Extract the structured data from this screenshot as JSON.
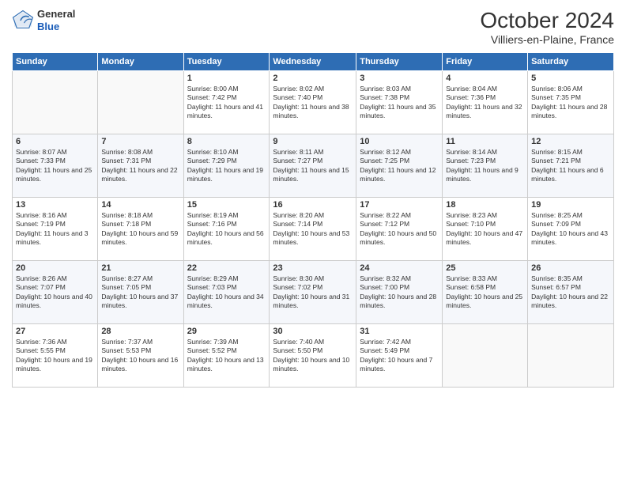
{
  "header": {
    "logo": {
      "general": "General",
      "blue": "Blue"
    },
    "title": "October 2024",
    "subtitle": "Villiers-en-Plaine, France"
  },
  "days_of_week": [
    "Sunday",
    "Monday",
    "Tuesday",
    "Wednesday",
    "Thursday",
    "Friday",
    "Saturday"
  ],
  "weeks": [
    [
      null,
      null,
      {
        "day": 1,
        "sunrise": "8:00 AM",
        "sunset": "7:42 PM",
        "daylight": "11 hours and 41 minutes."
      },
      {
        "day": 2,
        "sunrise": "8:02 AM",
        "sunset": "7:40 PM",
        "daylight": "11 hours and 38 minutes."
      },
      {
        "day": 3,
        "sunrise": "8:03 AM",
        "sunset": "7:38 PM",
        "daylight": "11 hours and 35 minutes."
      },
      {
        "day": 4,
        "sunrise": "8:04 AM",
        "sunset": "7:36 PM",
        "daylight": "11 hours and 32 minutes."
      },
      {
        "day": 5,
        "sunrise": "8:06 AM",
        "sunset": "7:35 PM",
        "daylight": "11 hours and 28 minutes."
      }
    ],
    [
      {
        "day": 6,
        "sunrise": "8:07 AM",
        "sunset": "7:33 PM",
        "daylight": "11 hours and 25 minutes."
      },
      {
        "day": 7,
        "sunrise": "8:08 AM",
        "sunset": "7:31 PM",
        "daylight": "11 hours and 22 minutes."
      },
      {
        "day": 8,
        "sunrise": "8:10 AM",
        "sunset": "7:29 PM",
        "daylight": "11 hours and 19 minutes."
      },
      {
        "day": 9,
        "sunrise": "8:11 AM",
        "sunset": "7:27 PM",
        "daylight": "11 hours and 15 minutes."
      },
      {
        "day": 10,
        "sunrise": "8:12 AM",
        "sunset": "7:25 PM",
        "daylight": "11 hours and 12 minutes."
      },
      {
        "day": 11,
        "sunrise": "8:14 AM",
        "sunset": "7:23 PM",
        "daylight": "11 hours and 9 minutes."
      },
      {
        "day": 12,
        "sunrise": "8:15 AM",
        "sunset": "7:21 PM",
        "daylight": "11 hours and 6 minutes."
      }
    ],
    [
      {
        "day": 13,
        "sunrise": "8:16 AM",
        "sunset": "7:19 PM",
        "daylight": "11 hours and 3 minutes."
      },
      {
        "day": 14,
        "sunrise": "8:18 AM",
        "sunset": "7:18 PM",
        "daylight": "10 hours and 59 minutes."
      },
      {
        "day": 15,
        "sunrise": "8:19 AM",
        "sunset": "7:16 PM",
        "daylight": "10 hours and 56 minutes."
      },
      {
        "day": 16,
        "sunrise": "8:20 AM",
        "sunset": "7:14 PM",
        "daylight": "10 hours and 53 minutes."
      },
      {
        "day": 17,
        "sunrise": "8:22 AM",
        "sunset": "7:12 PM",
        "daylight": "10 hours and 50 minutes."
      },
      {
        "day": 18,
        "sunrise": "8:23 AM",
        "sunset": "7:10 PM",
        "daylight": "10 hours and 47 minutes."
      },
      {
        "day": 19,
        "sunrise": "8:25 AM",
        "sunset": "7:09 PM",
        "daylight": "10 hours and 43 minutes."
      }
    ],
    [
      {
        "day": 20,
        "sunrise": "8:26 AM",
        "sunset": "7:07 PM",
        "daylight": "10 hours and 40 minutes."
      },
      {
        "day": 21,
        "sunrise": "8:27 AM",
        "sunset": "7:05 PM",
        "daylight": "10 hours and 37 minutes."
      },
      {
        "day": 22,
        "sunrise": "8:29 AM",
        "sunset": "7:03 PM",
        "daylight": "10 hours and 34 minutes."
      },
      {
        "day": 23,
        "sunrise": "8:30 AM",
        "sunset": "7:02 PM",
        "daylight": "10 hours and 31 minutes."
      },
      {
        "day": 24,
        "sunrise": "8:32 AM",
        "sunset": "7:00 PM",
        "daylight": "10 hours and 28 minutes."
      },
      {
        "day": 25,
        "sunrise": "8:33 AM",
        "sunset": "6:58 PM",
        "daylight": "10 hours and 25 minutes."
      },
      {
        "day": 26,
        "sunrise": "8:35 AM",
        "sunset": "6:57 PM",
        "daylight": "10 hours and 22 minutes."
      }
    ],
    [
      {
        "day": 27,
        "sunrise": "7:36 AM",
        "sunset": "5:55 PM",
        "daylight": "10 hours and 19 minutes."
      },
      {
        "day": 28,
        "sunrise": "7:37 AM",
        "sunset": "5:53 PM",
        "daylight": "10 hours and 16 minutes."
      },
      {
        "day": 29,
        "sunrise": "7:39 AM",
        "sunset": "5:52 PM",
        "daylight": "10 hours and 13 minutes."
      },
      {
        "day": 30,
        "sunrise": "7:40 AM",
        "sunset": "5:50 PM",
        "daylight": "10 hours and 10 minutes."
      },
      {
        "day": 31,
        "sunrise": "7:42 AM",
        "sunset": "5:49 PM",
        "daylight": "10 hours and 7 minutes."
      },
      null,
      null
    ]
  ],
  "labels": {
    "sunrise": "Sunrise:",
    "sunset": "Sunset:",
    "daylight": "Daylight:"
  }
}
